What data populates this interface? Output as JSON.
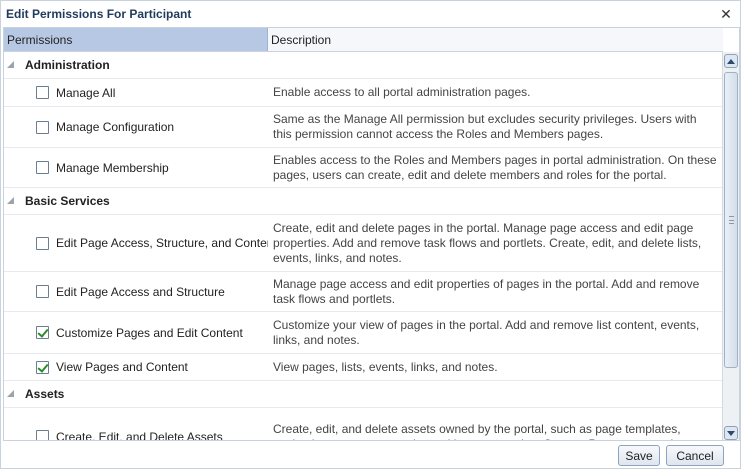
{
  "dialog": {
    "title": "Edit Permissions For Participant",
    "close_icon": "close-icon"
  },
  "table": {
    "columns": [
      "Permissions",
      "Description"
    ]
  },
  "groups": [
    {
      "label": "Administration",
      "rows": [
        {
          "label": "Manage All",
          "checked": false,
          "description": "Enable access to all portal administration pages."
        },
        {
          "label": "Manage Configuration",
          "checked": false,
          "description": "Same as the Manage All permission but excludes security privileges. Users with this permission cannot access the Roles and Members pages."
        },
        {
          "label": "Manage Membership",
          "checked": false,
          "description": "Enables access to the Roles and Members pages in portal administration. On these pages, users can create, edit and delete members and roles for the portal."
        }
      ]
    },
    {
      "label": "Basic Services",
      "rows": [
        {
          "label": "Edit Page Access, Structure, and Content",
          "checked": false,
          "description": "Create, edit and delete pages in the portal. Manage page access and edit page properties. Add and remove task flows and portlets. Create, edit, and delete lists, events, links, and notes."
        },
        {
          "label": "Edit Page Access and Structure",
          "checked": false,
          "description": "Manage page access and edit properties of pages in the portal. Add and remove task flows and portlets."
        },
        {
          "label": "Customize Pages and Edit Content",
          "checked": true,
          "description": "Customize your view of pages in the portal. Add and remove list content, events, links, and notes."
        },
        {
          "label": "View Pages and Content",
          "checked": true,
          "description": "View pages, lists, events, links, and notes."
        }
      ]
    },
    {
      "label": "Assets",
      "rows": [
        {
          "label": "Create, Edit, and Delete Assets",
          "checked": false,
          "description": "Create, edit, and delete assets owned by the portal, such as page templates, navigations, resource catalogs, skins, page styles, Content Presenter templates,"
        }
      ]
    }
  ],
  "footer": {
    "save_label": "Save",
    "cancel_label": "Cancel"
  }
}
